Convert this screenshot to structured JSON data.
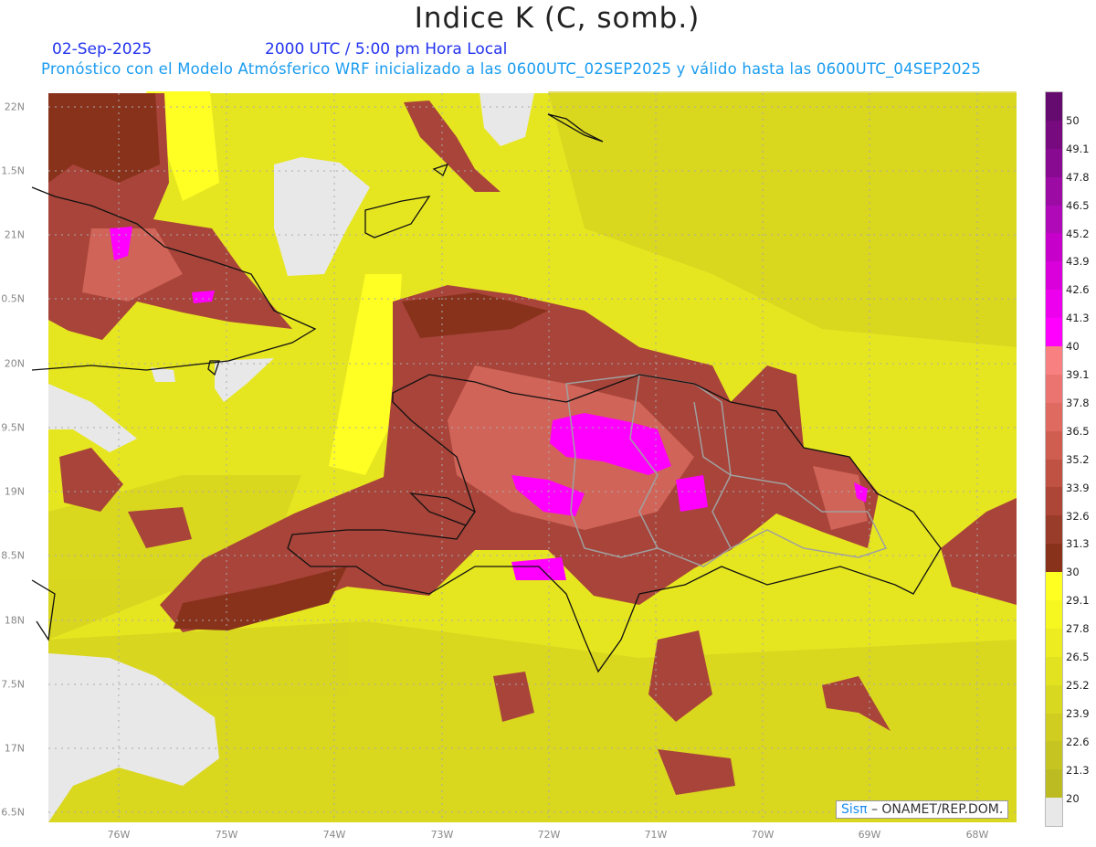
{
  "header": {
    "title": "Indice K (C, somb.)",
    "date": "02-Sep-2025",
    "time": "2000 UTC / 5:00 pm Hora Local",
    "subtitle": "Pronóstico con el Modelo Atmósferico WRF inicializado a las 0600UTC_02SEP2025 y válido hasta las  0600UTC_04SEP2025"
  },
  "axes": {
    "lat_labels": [
      "22N",
      "1.5N",
      "21N",
      "0.5N",
      "20N",
      "9.5N",
      "19N",
      "8.5N",
      "18N",
      "7.5N",
      "17N",
      "6.5N"
    ],
    "lon_labels": [
      "76W",
      "75W",
      "74W",
      "73W",
      "72W",
      "71W",
      "70W",
      "69W",
      "68W"
    ]
  },
  "colorbar": {
    "labels": [
      "50",
      "49.1",
      "47.8",
      "46.5",
      "45.2",
      "43.9",
      "42.6",
      "41.3",
      "40",
      "39.1",
      "37.8",
      "36.5",
      "35.2",
      "33.9",
      "32.6",
      "31.3",
      "30",
      "29.1",
      "27.8",
      "26.5",
      "25.2",
      "23.9",
      "22.6",
      "21.3",
      "20"
    ],
    "colors": [
      "#650a6e",
      "#760a7e",
      "#880a90",
      "#9c0ca4",
      "#b00ab8",
      "#c600ca",
      "#da00dc",
      "#ec00ee",
      "#ff00ff",
      "#f88080",
      "#ec7470",
      "#df6a60",
      "#cf5e50",
      "#bf5242",
      "#ad4636",
      "#9a3c2a",
      "#88321c",
      "#ffff22",
      "#f6f620",
      "#ecec20",
      "#e2e220",
      "#d8d820",
      "#d0cc20",
      "#c6c420",
      "#bcbc22",
      "#e8e8e8"
    ]
  },
  "credit": {
    "brand": "Sisπ",
    "text": " – ONAMET/REP.DOM."
  }
}
